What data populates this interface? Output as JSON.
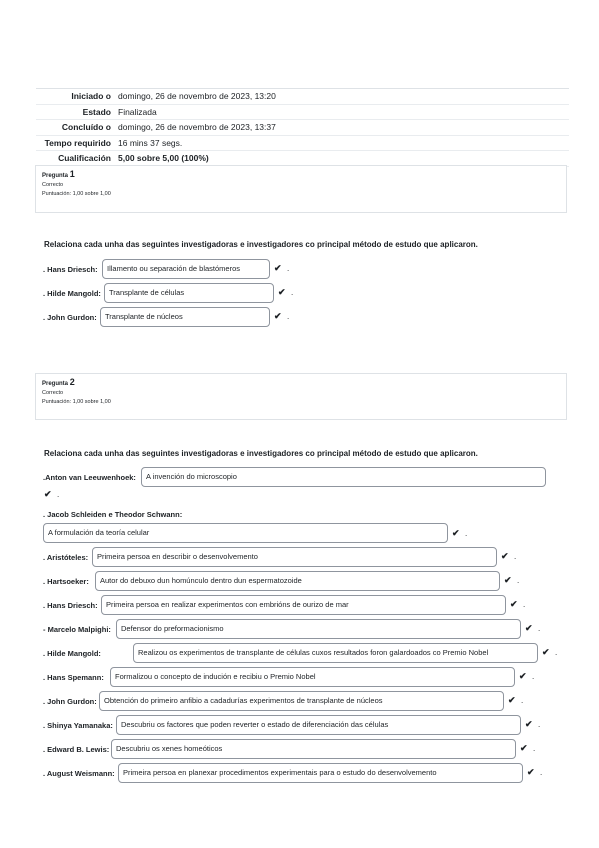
{
  "summary": [
    {
      "key": "Iniciado o",
      "value": "domingo, 26 de novembro de 2023, 13:20"
    },
    {
      "key": "Estado",
      "value": "Finalizada"
    },
    {
      "key": "Concluído o",
      "value": "domingo, 26 de novembro de 2023, 13:37"
    },
    {
      "key": "Tempo requirido",
      "value": "16 mins 37 segs."
    },
    {
      "key": "Cualificación",
      "value": "5,00 sobre 5,00 (100%)"
    }
  ],
  "q1": {
    "label": "Pregunta",
    "number": "1",
    "state": "Correcto",
    "grade": "Puntuación: 1,00 sobre 1,00",
    "text": "Relaciona cada unha das seguintes investigadoras e investigadores co principal método de estudo que aplicaron.",
    "rows": [
      {
        "label": ". Hans Driesch:",
        "answer": "Illamento ou separación de blastómeros"
      },
      {
        "label": ". Hilde Mangold:",
        "answer": "Transplante de células"
      },
      {
        "label": ". John Gurdon:",
        "answer": "Transplante de núcleos"
      }
    ]
  },
  "q2": {
    "label": "Pregunta",
    "number": "2",
    "state": "Correcto",
    "grade": "Puntuación: 1,00 sobre 1,00",
    "text": "Relaciona cada unha das seguintes investigadoras e investigadores co principal método de estudo que aplicaron.",
    "rows": [
      {
        "label": ".Anton van Leeuwenhoek:",
        "answer": "A invención do microscopio"
      },
      {
        "label": ". Jacob Schleiden e Theodor Schwann:",
        "answer": "A formulación da teoría celular"
      },
      {
        "label": ". Aristóteles:",
        "answer": "Primeira persoa en describir o desenvolvemento"
      },
      {
        "label": ". Hartsoeker:",
        "answer": "Autor do debuxo dun homúnculo dentro dun espermatozoide"
      },
      {
        "label": ". Hans Driesch:",
        "answer": "Primeira persoa en realizar experimentos con embrións de ourizo de mar"
      },
      {
        "label": "- Marcelo Malpighi:",
        "answer": "Defensor do preformacionismo"
      },
      {
        "label": ". Hilde Mangold:",
        "answer": "Realizou os experimentos de transplante de células cuxos resultados foron galardoados co Premio Nobel"
      },
      {
        "label": ". Hans Spemann:",
        "answer": "Formalizou o concepto de indución e recibiu o Premio Nobel"
      },
      {
        "label": ". John Gurdon:",
        "answer": "Obtención do primeiro anfibio a cadadurías experimentos de transplante de núcleos"
      },
      {
        "label": ". Shinya Yamanaka:",
        "answer": "Descubriu os factores que poden reverter o estado de diferenciación das células"
      },
      {
        "label": ". Edward B. Lewis:",
        "answer": "Descubriu os xenes homeóticos"
      },
      {
        "label": ". August Weismann:",
        "answer": "Primeira persoa en planexar procedimentos experimentais para o estudo do desenvolvemento"
      }
    ]
  },
  "icons": {
    "correct": "check-icon"
  }
}
